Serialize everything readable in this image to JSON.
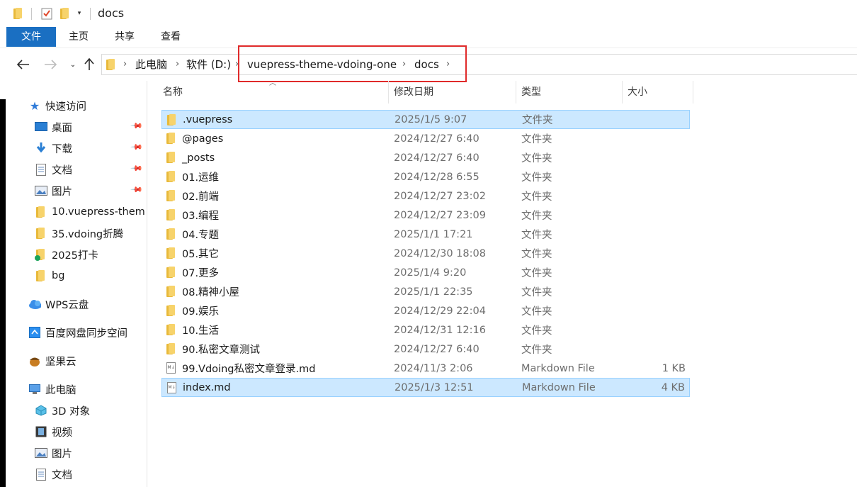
{
  "window": {
    "title": "docs"
  },
  "ribbon": {
    "tabs": [
      "文件",
      "主页",
      "共享",
      "查看"
    ]
  },
  "address": {
    "crumbs": [
      "此电脑",
      "软件 (D:)",
      "vuepress-theme-vdoing-one",
      "docs"
    ]
  },
  "sidebar": {
    "quick_access": "快速访问",
    "pinned": [
      "桌面",
      "下载",
      "文档",
      "图片"
    ],
    "recent": [
      "10.vuepress-them",
      "35.vdoing折腾",
      "2025打卡",
      "bg"
    ],
    "wps": "WPS云盘",
    "baidu": "百度网盘同步空间",
    "jianguo": "坚果云",
    "this_pc": "此电脑",
    "pc_items": [
      "3D 对象",
      "视频",
      "图片",
      "文档"
    ]
  },
  "columns": {
    "name": "名称",
    "date": "修改日期",
    "type": "类型",
    "size": "大小"
  },
  "files": [
    {
      "name": ".vuepress",
      "date": "2025/1/5 9:07",
      "type": "文件夹",
      "size": "",
      "kind": "folder",
      "selected": true
    },
    {
      "name": "@pages",
      "date": "2024/12/27 6:40",
      "type": "文件夹",
      "size": "",
      "kind": "folder"
    },
    {
      "name": "_posts",
      "date": "2024/12/27 6:40",
      "type": "文件夹",
      "size": "",
      "kind": "folder"
    },
    {
      "name": "01.运维",
      "date": "2024/12/28 6:55",
      "type": "文件夹",
      "size": "",
      "kind": "folder"
    },
    {
      "name": "02.前端",
      "date": "2024/12/27 23:02",
      "type": "文件夹",
      "size": "",
      "kind": "folder"
    },
    {
      "name": "03.编程",
      "date": "2024/12/27 23:09",
      "type": "文件夹",
      "size": "",
      "kind": "folder"
    },
    {
      "name": "04.专题",
      "date": "2025/1/1 17:21",
      "type": "文件夹",
      "size": "",
      "kind": "folder"
    },
    {
      "name": "05.其它",
      "date": "2024/12/30 18:08",
      "type": "文件夹",
      "size": "",
      "kind": "folder"
    },
    {
      "name": "07.更多",
      "date": "2025/1/4 9:20",
      "type": "文件夹",
      "size": "",
      "kind": "folder"
    },
    {
      "name": "08.精神小屋",
      "date": "2025/1/1 22:35",
      "type": "文件夹",
      "size": "",
      "kind": "folder"
    },
    {
      "name": "09.娱乐",
      "date": "2024/12/29 22:04",
      "type": "文件夹",
      "size": "",
      "kind": "folder"
    },
    {
      "name": "10.生活",
      "date": "2024/12/31 12:16",
      "type": "文件夹",
      "size": "",
      "kind": "folder"
    },
    {
      "name": "90.私密文章测试",
      "date": "2024/12/27 6:40",
      "type": "文件夹",
      "size": "",
      "kind": "folder"
    },
    {
      "name": "99.Vdoing私密文章登录.md",
      "date": "2024/11/3 2:06",
      "type": "Markdown File",
      "size": "1 KB",
      "kind": "md"
    },
    {
      "name": "index.md",
      "date": "2025/1/3 12:51",
      "type": "Markdown File",
      "size": "4 KB",
      "kind": "md",
      "selected": true
    }
  ],
  "colors": {
    "accent": "#1a6fc2",
    "selection": "#cce8ff",
    "highlight_box": "#e02a2a"
  }
}
